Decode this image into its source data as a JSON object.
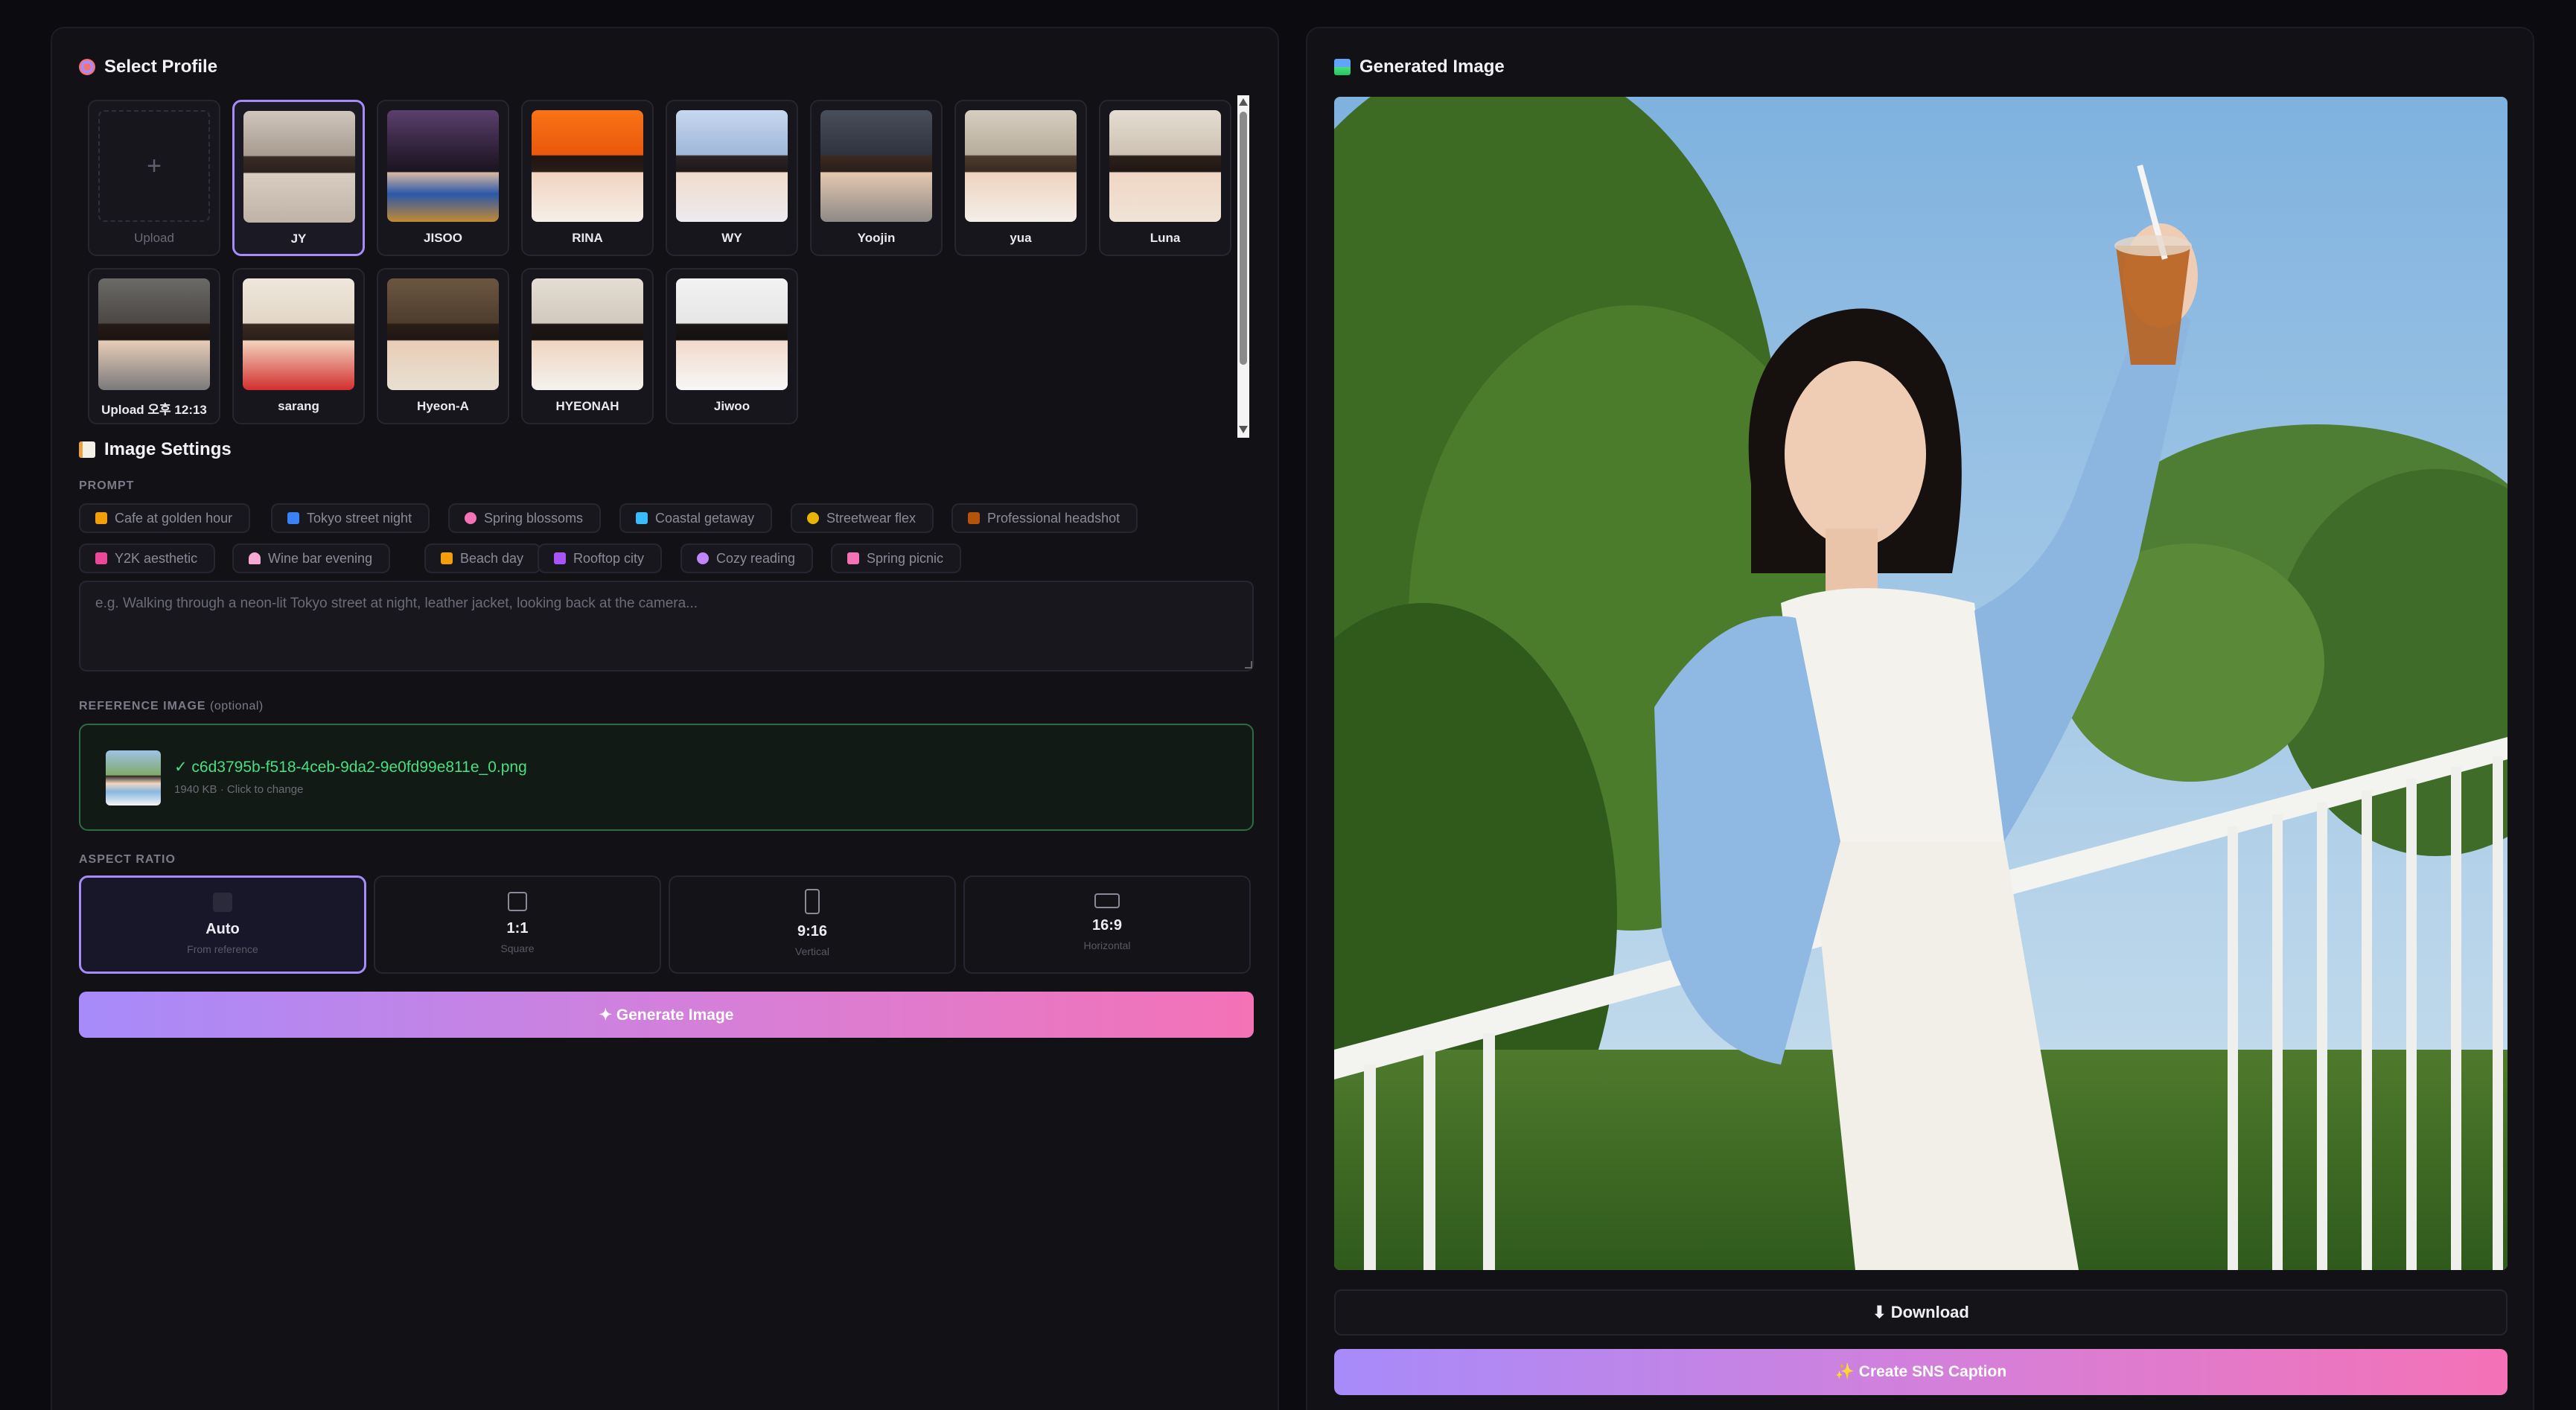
{
  "profiles": {
    "title": "Select Profile",
    "upload_label": "Upload",
    "items": [
      {
        "name": "JY",
        "selected": true
      },
      {
        "name": "JISOO"
      },
      {
        "name": "RINA"
      },
      {
        "name": "WY"
      },
      {
        "name": "Yoojin"
      },
      {
        "name": "yua"
      },
      {
        "name": "Luna"
      },
      {
        "name": "Upload 오후 12:13"
      },
      {
        "name": "sarang"
      },
      {
        "name": "Hyeon-A"
      },
      {
        "name": "HYEONAH"
      },
      {
        "name": "Jiwoo"
      }
    ]
  },
  "settings": {
    "title": "Image Settings",
    "prompt_label": "PROMPT",
    "prompt_placeholder": "e.g. Walking through a neon-lit Tokyo street at night, leather jacket, looking back at the camera...",
    "prompt_value": "",
    "presets": [
      {
        "label": "Cafe at golden hour",
        "icon_color": "#f59e0b"
      },
      {
        "label": "Tokyo street night",
        "icon_color": "#3b82f6"
      },
      {
        "label": "Spring blossoms",
        "icon_color": "#f472b6"
      },
      {
        "label": "Coastal getaway",
        "icon_color": "#38bdf8"
      },
      {
        "label": "Streetwear flex",
        "icon_color": "#eab308"
      },
      {
        "label": "Professional headshot",
        "icon_color": "#b45309"
      },
      {
        "label": "Y2K aesthetic",
        "icon_color": "#ec4899"
      },
      {
        "label": "Wine bar evening",
        "icon_color": "#f9a8d4"
      },
      {
        "label": "Beach day",
        "icon_color": "#f59e0b"
      },
      {
        "label": "Rooftop city",
        "icon_color": "#a855f7"
      },
      {
        "label": "Cozy reading",
        "icon_color": "#c084fc"
      },
      {
        "label": "Spring picnic",
        "icon_color": "#f472b6"
      }
    ],
    "reference_label": "REFERENCE IMAGE",
    "reference_optional": "(optional)",
    "reference_file": "✓ c6d3795b-f518-4ceb-9da2-9e0fd99e811e_0.png",
    "reference_meta": "1940 KB · Click to change",
    "aspect_label": "ASPECT RATIO",
    "aspect_options": [
      {
        "value": "Auto",
        "sub": "From reference",
        "selected": true
      },
      {
        "value": "1:1",
        "sub": "Square"
      },
      {
        "value": "9:16",
        "sub": "Vertical"
      },
      {
        "value": "16:9",
        "sub": "Horizontal"
      }
    ],
    "generate_label": "✦ Generate Image"
  },
  "output": {
    "title": "Generated Image",
    "download_label": "⬇ Download",
    "caption_label": "✨ Create SNS Caption"
  },
  "colors": {
    "accent": "#a78bfa",
    "gradient_end": "#f472b6",
    "success": "#4ade80",
    "panel_bg": "#111116",
    "page_bg": "#0b0b10"
  }
}
